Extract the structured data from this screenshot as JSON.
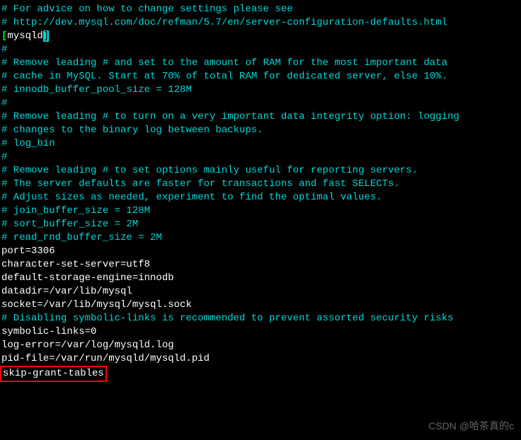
{
  "lines": {
    "l1": "# For advice on how to change settings please see",
    "l2": "# http://dev.mysql.com/doc/refman/5.7/en/server-configuration-defaults.html",
    "l3": "",
    "l4_open": "[",
    "l4_text": "mysqld",
    "l4_close": "]",
    "l5": "#",
    "l6": "# Remove leading # and set to the amount of RAM for the most important data",
    "l7": "# cache in MySQL. Start at 70% of total RAM for dedicated server, else 10%.",
    "l8": "# innodb_buffer_pool_size = 128M",
    "l9": "#",
    "l10": "# Remove leading # to turn on a very important data integrity option: logging",
    "l11": "# changes to the binary log between backups.",
    "l12": "# log_bin",
    "l13": "#",
    "l14": "# Remove leading # to set options mainly useful for reporting servers.",
    "l15": "# The server defaults are faster for transactions and fast SELECTs.",
    "l16": "# Adjust sizes as needed, experiment to find the optimal values.",
    "l17": "# join_buffer_size = 128M",
    "l18": "# sort_buffer_size = 2M",
    "l19": "# read_rnd_buffer_size = 2M",
    "l20": "port=3306",
    "l21": "character-set-server=utf8",
    "l22": "default-storage-engine=innodb",
    "l23": "",
    "l24": "datadir=/var/lib/mysql",
    "l25": "socket=/var/lib/mysql/mysql.sock",
    "l26": "",
    "l27": "# Disabling symbolic-links is recommended to prevent assorted security risks",
    "l28": "symbolic-links=0",
    "l29": "",
    "l30": "log-error=/var/log/mysqld.log",
    "l31": "pid-file=/var/run/mysqld/mysqld.pid",
    "l32": "skip-grant-tables"
  },
  "watermark": "CSDN @哈茶真的c"
}
